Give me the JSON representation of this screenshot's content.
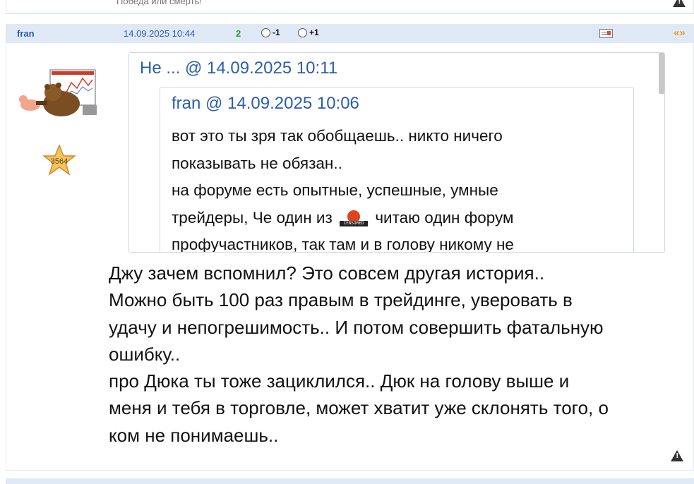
{
  "previous_post": {
    "signature": "Победа или смерть!"
  },
  "post": {
    "author": "fran",
    "date": "14.09.2025 10:44",
    "score": "2",
    "vote_minus": "-1",
    "vote_plus": "+1",
    "quote_icon": "«»",
    "avatar_icon": "bear-trader-avatar",
    "rating_badge": "3564",
    "quote_outer": {
      "header": "Не ... @ 14.09.2025 10:11"
    },
    "quote_inner": {
      "header": "fran @ 14.09.2025 10:06",
      "lines": [
        "вот это ты зря так обобщаешь.. никто ничего",
        "показывать не обязан..",
        "на форуме есть опытные, успешные, умные",
        "трейдеры, Че один из",
        "читаю один форум",
        "профучастников, так там и в голову никому не"
      ],
      "censored_label": "CENSORED"
    },
    "body_lines": [
      "Джу зачем вспомнил? Это совсем другая история..",
      "Можно быть 100 раз правым в трейдинге, уверовать в",
      "удачу и непогрешимость.. И потом совершить фатальную",
      "ошибку..",
      "про Дюка ты тоже зациклился.. Дюк на голову выше и",
      "меня и тебя в торговле, может хватит уже склонять того, о",
      "ком не понимаешь.."
    ],
    "icons": {
      "report": "warning-icon",
      "card": "card-icon",
      "star": "star-icon"
    },
    "colors": {
      "header_bg": "#dfe9f6",
      "link": "#2a5db0",
      "score": "#2e9b2e",
      "quote_icon": "#f29a1d"
    }
  }
}
